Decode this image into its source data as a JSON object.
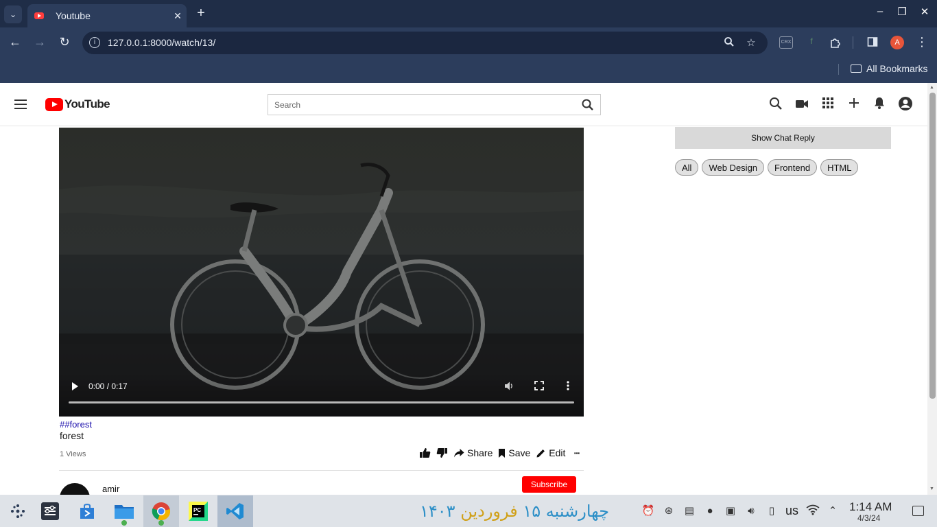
{
  "browser": {
    "tab_title": "Youtube",
    "url": "127.0.0.1:8000/watch/13/",
    "bookmarks_label": "All Bookmarks",
    "profile_initial": "A",
    "ext_crx_label": "CRX"
  },
  "header": {
    "logo_text": "YouTube",
    "search_placeholder": "Search"
  },
  "video": {
    "time": "0:00 / 0:17",
    "progress": 0.0,
    "hashtag": "##forest",
    "title": "forest",
    "views": "1 Views"
  },
  "actions": {
    "share": "Share",
    "save": "Save",
    "edit": "Edit",
    "more": "···"
  },
  "channel": {
    "name": "amir",
    "subscribe_label": "Subscribe"
  },
  "sidebar": {
    "chat_reply_label": "Show Chat Reply",
    "chips": [
      "All",
      "Web Design",
      "Frontend",
      "HTML"
    ]
  },
  "taskbar": {
    "persian_day": "چهارشنبه ۱۵",
    "persian_month": "فروردین",
    "persian_year": "۱۴۰۳",
    "language": "us",
    "time": "1:14 AM",
    "date": "4/3/24"
  },
  "colors": {
    "browser_frame": "#1f2d47",
    "browser_toolbar": "#2c3d5c",
    "youtube_red": "#ff0000",
    "subscribe_red": "#ff0000",
    "link_blue": "#1a0dab"
  }
}
